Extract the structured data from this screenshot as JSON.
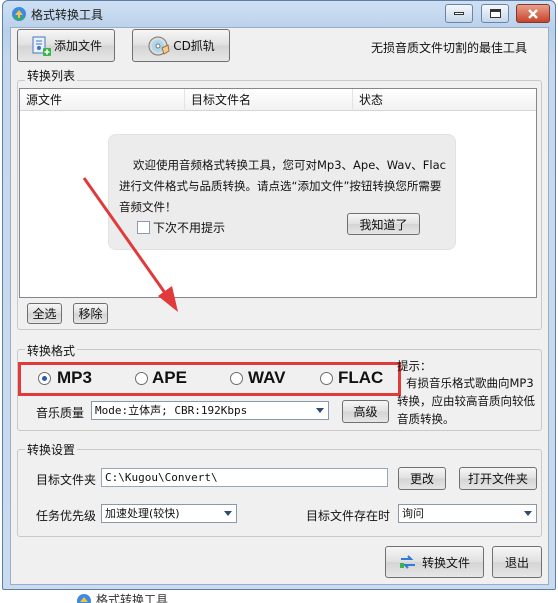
{
  "window": {
    "title": "格式转换工具",
    "background_title": "格式转换工具"
  },
  "toolbar": {
    "add_file_label": "添加文件",
    "cd_rip_label": "CD抓轨",
    "slogan": "无损音质文件切割的最佳工具"
  },
  "list_section": {
    "label": "转换列表",
    "columns": [
      "源文件",
      "目标文件名",
      "状态"
    ],
    "select_all_label": "全选",
    "remove_label": "移除"
  },
  "welcome": {
    "message": "欢迎使用音频格式转换工具，您可对Mp3、Ape、Wav、Flac进行文件格式与品质转换。请点选“添加文件”按钮转换您所需要音频文件！",
    "dont_show_label": "下次不用提示",
    "got_it_label": "我知道了"
  },
  "format_section": {
    "label": "转换格式",
    "options": [
      "MP3",
      "APE",
      "WAV",
      "FLAC"
    ],
    "selected": "MP3",
    "quality_label": "音乐质量",
    "quality_value": "Mode:立体声; CBR:192Kbps",
    "advanced_label": "高级",
    "hint_title": "提示：",
    "hint_text": "有损音乐格式歌曲向MP3转换，应由较高音质向较低音质转换。"
  },
  "settings_section": {
    "label": "转换设置",
    "target_folder_label": "目标文件夹",
    "target_folder_value": "C:\\Kugou\\Convert\\",
    "change_label": "更改",
    "open_folder_label": "打开文件夹",
    "priority_label": "任务优先级",
    "priority_value": "加速处理(较快)",
    "exists_label": "目标文件存在时",
    "exists_value": "询问"
  },
  "actions": {
    "convert_label": "转换文件",
    "exit_label": "退出"
  },
  "colors": {
    "annotation_red": "#e03a3a",
    "title_gradient": "#c5d8ee"
  }
}
